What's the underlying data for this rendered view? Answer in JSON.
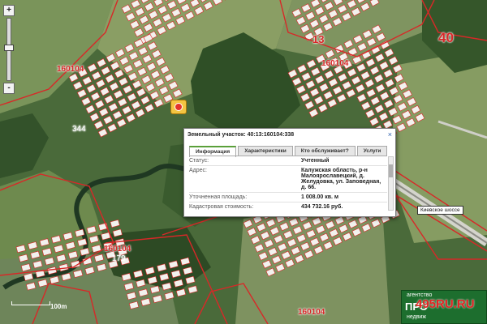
{
  "map": {
    "quarter_labels": [
      "13",
      "40",
      "160104",
      "160104",
      "160104",
      "160104"
    ],
    "plot_numbers": [
      "344",
      "179"
    ],
    "colors": {
      "forest": "#3c5e2e",
      "meadow": "#7a945a",
      "boundary": "#d82828",
      "plot": "#f2f2ee"
    }
  },
  "zoom_control": {
    "zoom_in": "+",
    "zoom_out": "-"
  },
  "marker": {
    "icon": "map-pin-icon"
  },
  "popup": {
    "title": "Земельный участок: 40:13:160104:338",
    "close": "×",
    "tabs": [
      "Информация",
      "Характеристики",
      "Кто обслуживает?",
      "Услуги"
    ],
    "rows": [
      {
        "label": "Статус:",
        "value": "Учтенный"
      },
      {
        "label": "Адрес:",
        "value": "Калужская область, р-н Малоярославецкий, д. Желудовка, ул. Заповедная, д. 66."
      },
      {
        "label": "Уточненная площадь:",
        "value": "1 008.00 кв. м"
      },
      {
        "label": "Кадастровая стоимость:",
        "value": "434 732.16 руб."
      }
    ]
  },
  "road_label": "Киевское шоссе",
  "scale": "100m",
  "watermark": {
    "top": "агентство",
    "main": "ПРО",
    "url": "495RU.RU",
    "bottom": "недвиж"
  }
}
